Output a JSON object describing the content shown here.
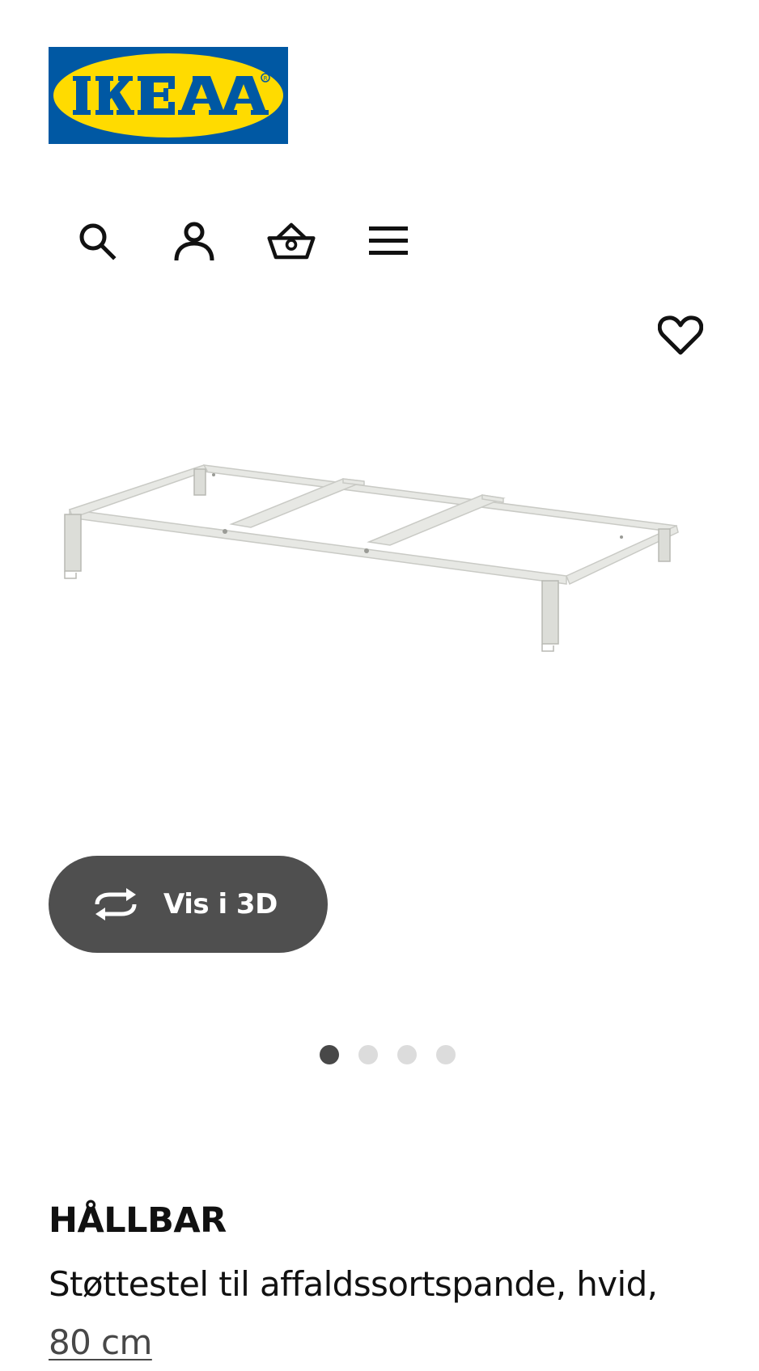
{
  "header": {
    "logo_text": "IKEA",
    "brand_colors": {
      "blue": "#0058a3",
      "yellow": "#ffdb00"
    },
    "nav": [
      {
        "icon": "search-icon",
        "label": ""
      },
      {
        "icon": "user-icon",
        "label": ""
      },
      {
        "icon": "basket-icon",
        "label": ""
      },
      {
        "icon": "menu-icon",
        "label": ""
      }
    ]
  },
  "gallery": {
    "favorite_icon": "heart-icon",
    "view_3d_label": "Vis i 3D",
    "view_3d_icon": "rotate-icon",
    "dot_count": 4,
    "active_dot": 0
  },
  "product": {
    "name": "HÅLLBAR",
    "description": "Støttestel til affaldssortspande, hvid,",
    "size": "80 cm"
  }
}
